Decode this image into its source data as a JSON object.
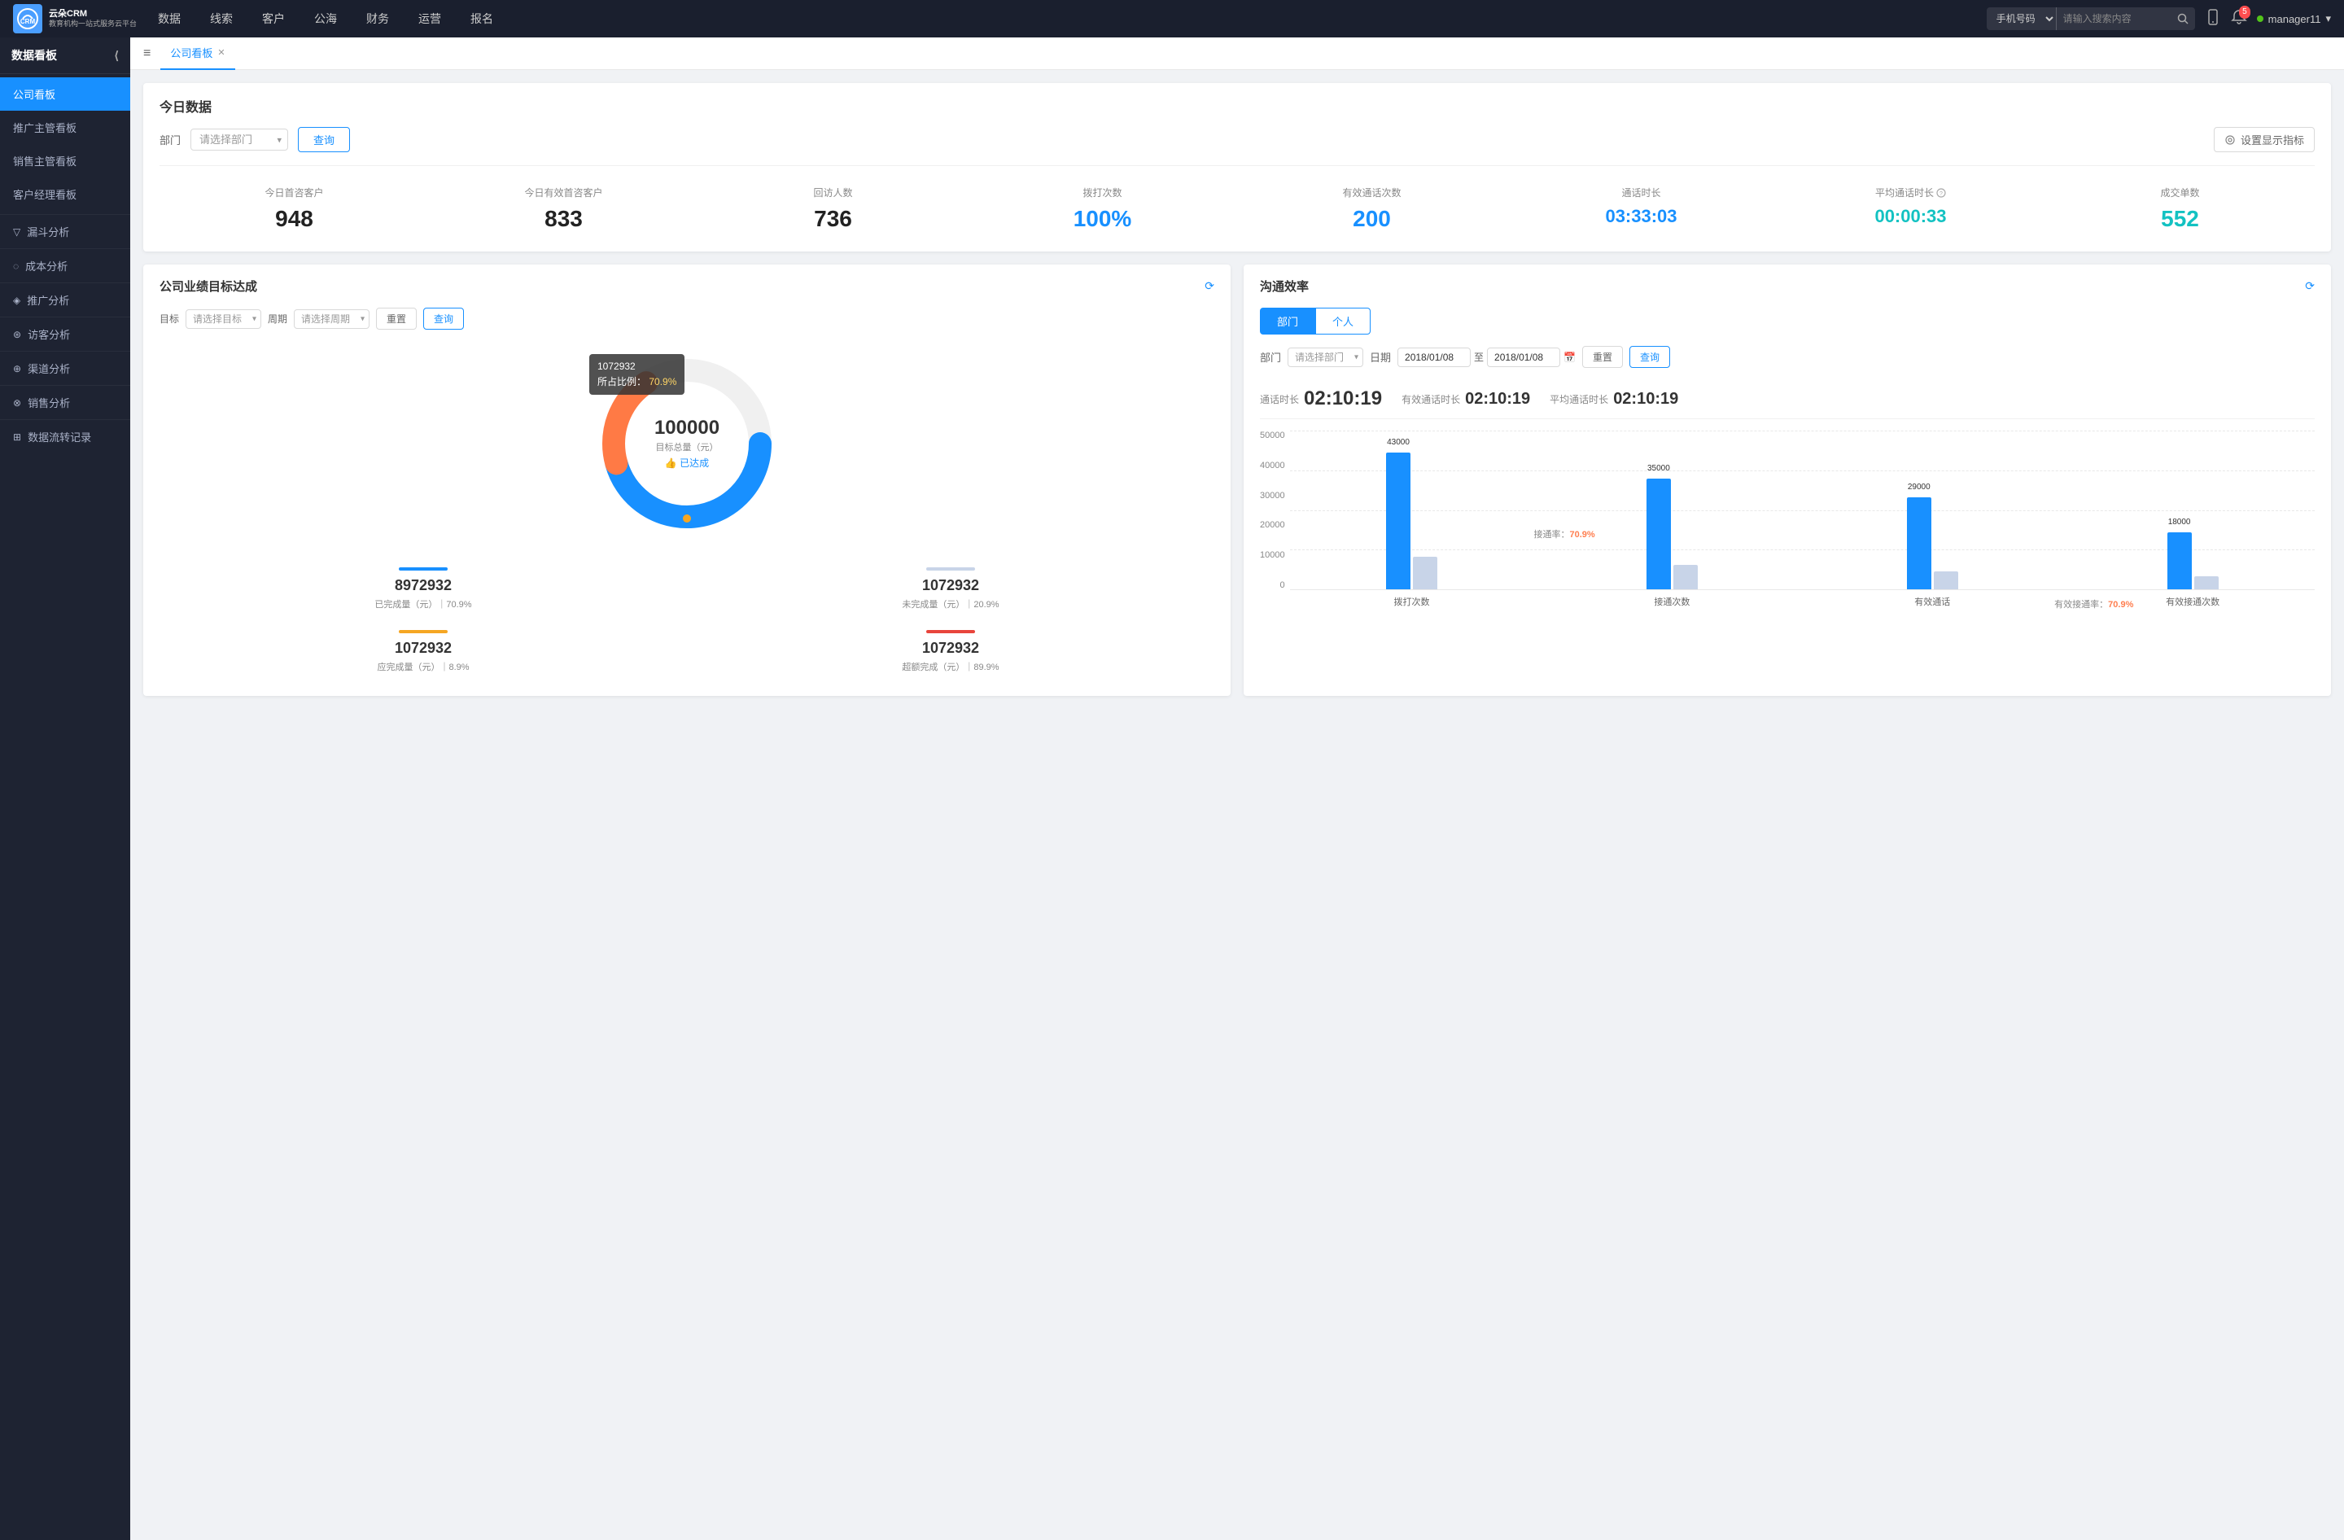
{
  "app": {
    "logo_text1": "云朵CRM",
    "logo_text2": "教育机构一站式服务云平台"
  },
  "nav": {
    "items": [
      "数据",
      "线索",
      "客户",
      "公海",
      "财务",
      "运营",
      "报名"
    ],
    "search_placeholder": "请输入搜索内容",
    "search_type": "手机号码",
    "notification_count": "5",
    "username": "manager11"
  },
  "sidebar": {
    "group_label": "数据看板",
    "items": [
      {
        "label": "公司看板",
        "active": true
      },
      {
        "label": "推广主管看板",
        "active": false
      },
      {
        "label": "销售主管看板",
        "active": false
      },
      {
        "label": "客户经理看板",
        "active": false
      }
    ],
    "groups": [
      {
        "label": "漏斗分析"
      },
      {
        "label": "成本分析"
      },
      {
        "label": "推广分析"
      },
      {
        "label": "访客分析"
      },
      {
        "label": "渠道分析"
      },
      {
        "label": "销售分析"
      },
      {
        "label": "数据流转记录"
      }
    ]
  },
  "tabs": {
    "active_tab": "公司看板"
  },
  "today_data": {
    "title": "今日数据",
    "filter_label": "部门",
    "filter_placeholder": "请选择部门",
    "query_btn": "查询",
    "settings_btn": "设置显示指标",
    "metrics": [
      {
        "label": "今日首咨客户",
        "value": "948",
        "color": "dark"
      },
      {
        "label": "今日有效首咨客户",
        "value": "833",
        "color": "dark"
      },
      {
        "label": "回访人数",
        "value": "736",
        "color": "dark"
      },
      {
        "label": "拨打次数",
        "value": "100%",
        "color": "blue"
      },
      {
        "label": "有效通话次数",
        "value": "200",
        "color": "blue"
      },
      {
        "label": "通话时长",
        "value": "03:33:03",
        "color": "blue"
      },
      {
        "label": "平均通话时长",
        "value": "00:00:33",
        "color": "cyan"
      },
      {
        "label": "成交单数",
        "value": "552",
        "color": "cyan"
      }
    ]
  },
  "business_goals": {
    "title": "公司业绩目标达成",
    "filter": {
      "target_label": "目标",
      "target_placeholder": "请选择目标",
      "period_label": "周期",
      "period_placeholder": "请选择周期",
      "reset_btn": "重置",
      "query_btn": "查询"
    },
    "chart": {
      "center_value": "100000",
      "center_label": "目标总量（元）",
      "center_status": "👍 已达成",
      "tooltip_title": "1072932",
      "tooltip_pct_label": "所占比例：",
      "tooltip_pct": "70.9%"
    },
    "metrics": [
      {
        "value": "8972932",
        "desc": "已完成量（元）｜70.9%",
        "bar_color": "#1890ff"
      },
      {
        "value": "1072932",
        "desc": "未完成量（元）｜20.9%",
        "bar_color": "#c8d4e8"
      },
      {
        "value": "1072932",
        "desc": "应完成量（元）｜8.9%",
        "bar_color": "#f5a623"
      },
      {
        "value": "1072932",
        "desc": "超额完成（元）｜89.9%",
        "bar_color": "#e8453c"
      }
    ]
  },
  "comm_efficiency": {
    "title": "沟通效率",
    "tabs": [
      "部门",
      "个人"
    ],
    "active_tab": "部门",
    "filter": {
      "dept_label": "部门",
      "dept_placeholder": "请选择部门",
      "date_label": "日期",
      "date_from": "2018/01/08",
      "date_to": "2018/01/08",
      "date_sep": "至",
      "reset_btn": "重置",
      "query_btn": "查询"
    },
    "stats": {
      "call_duration_label": "通话时长",
      "call_duration": "02:10:19",
      "effective_duration_label": "有效通话时长",
      "effective_duration": "02:10:19",
      "avg_duration_label": "平均通话时长",
      "avg_duration": "02:10:19"
    },
    "chart": {
      "y_axis": [
        "50000",
        "40000",
        "30000",
        "20000",
        "10000",
        "0"
      ],
      "groups": [
        {
          "label": "拨打次数",
          "bars": [
            {
              "value": 43000,
              "label": "43000",
              "color": "#1890ff",
              "height_pct": 86
            },
            {
              "value": 10000,
              "label": "",
              "color": "#c8d4e8",
              "height_pct": 20
            }
          ],
          "rate": null
        },
        {
          "label": "接通次数",
          "bars": [
            {
              "value": 35000,
              "label": "35000",
              "color": "#1890ff",
              "height_pct": 70
            },
            {
              "value": 8000,
              "label": "",
              "color": "#c8d4e8",
              "height_pct": 16
            }
          ],
          "rate": "接通率：70.9%"
        },
        {
          "label": "有效通话",
          "bars": [
            {
              "value": 29000,
              "label": "29000",
              "color": "#1890ff",
              "height_pct": 58
            },
            {
              "value": 6000,
              "label": "",
              "color": "#c8d4e8",
              "height_pct": 12
            }
          ],
          "rate": null
        },
        {
          "label": "有效接通次数",
          "bars": [
            {
              "value": 18000,
              "label": "18000",
              "color": "#1890ff",
              "height_pct": 36
            },
            {
              "value": 4000,
              "label": "",
              "color": "#c8d4e8",
              "height_pct": 8
            }
          ],
          "rate": "有效接通率：70.9%"
        }
      ]
    }
  }
}
